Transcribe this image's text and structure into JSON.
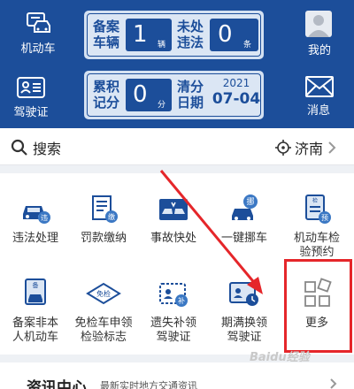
{
  "header": {
    "left_items": [
      {
        "label": "机动车",
        "icon": "car-icon"
      },
      {
        "label": "驾驶证",
        "icon": "license-card-icon"
      }
    ],
    "right_items": [
      {
        "label": "我的",
        "icon": "avatar-icon"
      },
      {
        "label": "消息",
        "icon": "envelope-icon"
      }
    ],
    "vehicle_panel": {
      "reg_label_1": "备案",
      "reg_label_2": "车辆",
      "reg_count": "1",
      "reg_unit": "辆",
      "viol_label_1": "未处",
      "viol_label_2": "违法",
      "viol_count": "0",
      "viol_unit": "条"
    },
    "license_panel": {
      "score_label_1": "累积",
      "score_label_2": "记分",
      "score": "0",
      "score_unit": "分",
      "date_label_1": "清分",
      "date_label_2": "日期",
      "date_year": "2021",
      "date_day": "07-04"
    }
  },
  "search": {
    "placeholder": "搜索",
    "city": "济南"
  },
  "services": [
    {
      "label_1": "违法处理",
      "label_2": "",
      "icon": "car-violation-icon"
    },
    {
      "label_1": "罚款缴纳",
      "label_2": "",
      "icon": "fine-payment-icon"
    },
    {
      "label_1": "事故快处",
      "label_2": "",
      "icon": "accident-icon"
    },
    {
      "label_1": "一键挪车",
      "label_2": "",
      "icon": "move-car-icon"
    },
    {
      "label_1": "机动车检",
      "label_2": "验预约",
      "icon": "inspection-booking-icon"
    },
    {
      "label_1": "备案非本",
      "label_2": "人机动车",
      "icon": "record-vehicle-icon"
    },
    {
      "label_1": "免检车申领",
      "label_2": "检验标志",
      "icon": "exempt-inspection-icon"
    },
    {
      "label_1": "遗失补领",
      "label_2": "驾驶证",
      "icon": "license-replace-icon"
    },
    {
      "label_1": "期满换领",
      "label_2": "驾驶证",
      "icon": "license-renew-icon"
    },
    {
      "label_1": "更多",
      "label_2": "",
      "icon": "more-grid-icon"
    }
  ],
  "news": {
    "title": "资讯中心",
    "subtitle": "最新实时地方交通资讯"
  },
  "watermark": "Baidu经验",
  "colors": {
    "brand_blue": "#1c4e9a",
    "highlight_red": "#e5262a"
  }
}
